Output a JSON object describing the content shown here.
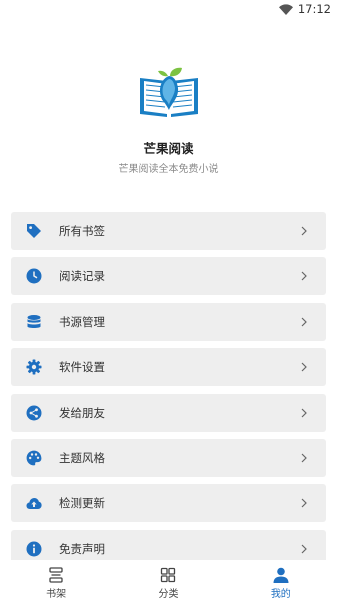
{
  "status": {
    "time": "17:12"
  },
  "app": {
    "name": "芒果阅读",
    "slogan": "芒果阅读全本免费小说"
  },
  "menu": [
    {
      "label": "所有书签",
      "icon": "tag-icon"
    },
    {
      "label": "阅读记录",
      "icon": "clock-icon"
    },
    {
      "label": "书源管理",
      "icon": "database-icon"
    },
    {
      "label": "软件设置",
      "icon": "gear-icon"
    },
    {
      "label": "发给朋友",
      "icon": "share-icon"
    },
    {
      "label": "主题风格",
      "icon": "palette-icon"
    },
    {
      "label": "检测更新",
      "icon": "cloud-upload-icon"
    },
    {
      "label": "免责声明",
      "icon": "info-icon"
    }
  ],
  "tabs": [
    {
      "label": "书架",
      "icon": "bookshelf-icon",
      "active": false
    },
    {
      "label": "分类",
      "icon": "grid-icon",
      "active": false
    },
    {
      "label": "我的",
      "icon": "person-icon",
      "active": true
    }
  ],
  "colors": {
    "accent": "#1f6fc0",
    "item_bg": "#eeeeee",
    "logo_green": "#7cc242"
  }
}
